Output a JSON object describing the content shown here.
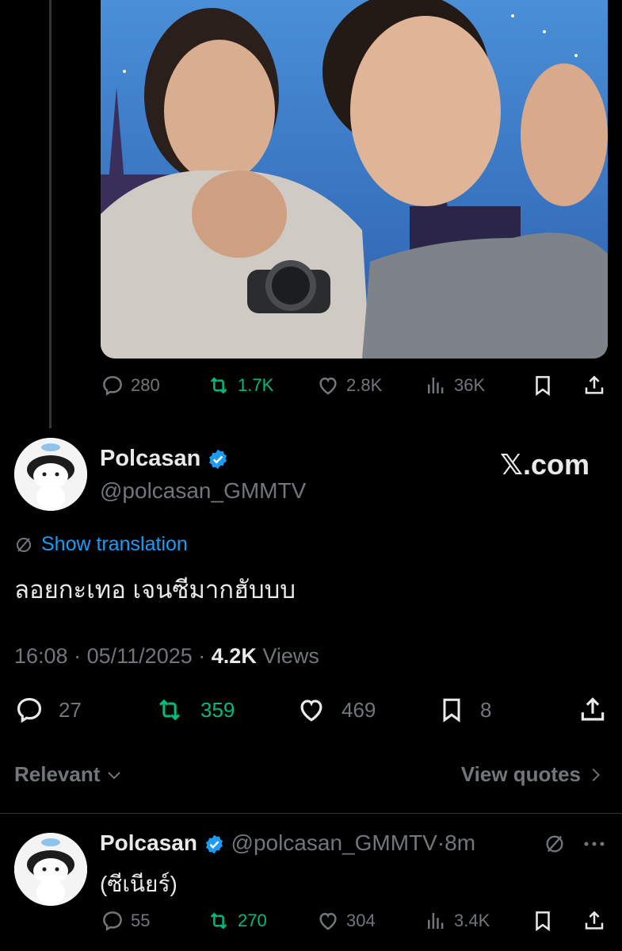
{
  "parent_tweet": {
    "stats": {
      "replies": "280",
      "retweets": "1.7K",
      "likes": "2.8K",
      "views": "36K"
    }
  },
  "main_tweet": {
    "display_name": "Polcasan",
    "handle": "@polcasan_GMMTV",
    "watermark": "𝕏.com",
    "show_translation": "Show translation",
    "text": "ลอยกะเทอ เจนซีมากฮับบบ",
    "time": "16:08",
    "date": "05/11/2025",
    "views_count": "4.2K",
    "views_label": "Views",
    "separator": "·",
    "stats": {
      "replies": "27",
      "retweets": "359",
      "likes": "469",
      "bookmarks": "8"
    }
  },
  "reply_bar": {
    "sort_label": "Relevant",
    "view_quotes": "View quotes"
  },
  "reply_tweet": {
    "display_name": "Polcasan",
    "handle": "@polcasan_GMMTV",
    "separator": "·",
    "time_ago": "8m",
    "text": "(ซีเนียร์)",
    "stats": {
      "replies": "55",
      "retweets": "270",
      "likes": "304",
      "views": "3.4K"
    }
  },
  "colors": {
    "background": "#000000",
    "text": "#e7e9ea",
    "muted": "#71767b",
    "accent_blue": "#1d9bf0",
    "retweet_green": "#00ba7c"
  }
}
